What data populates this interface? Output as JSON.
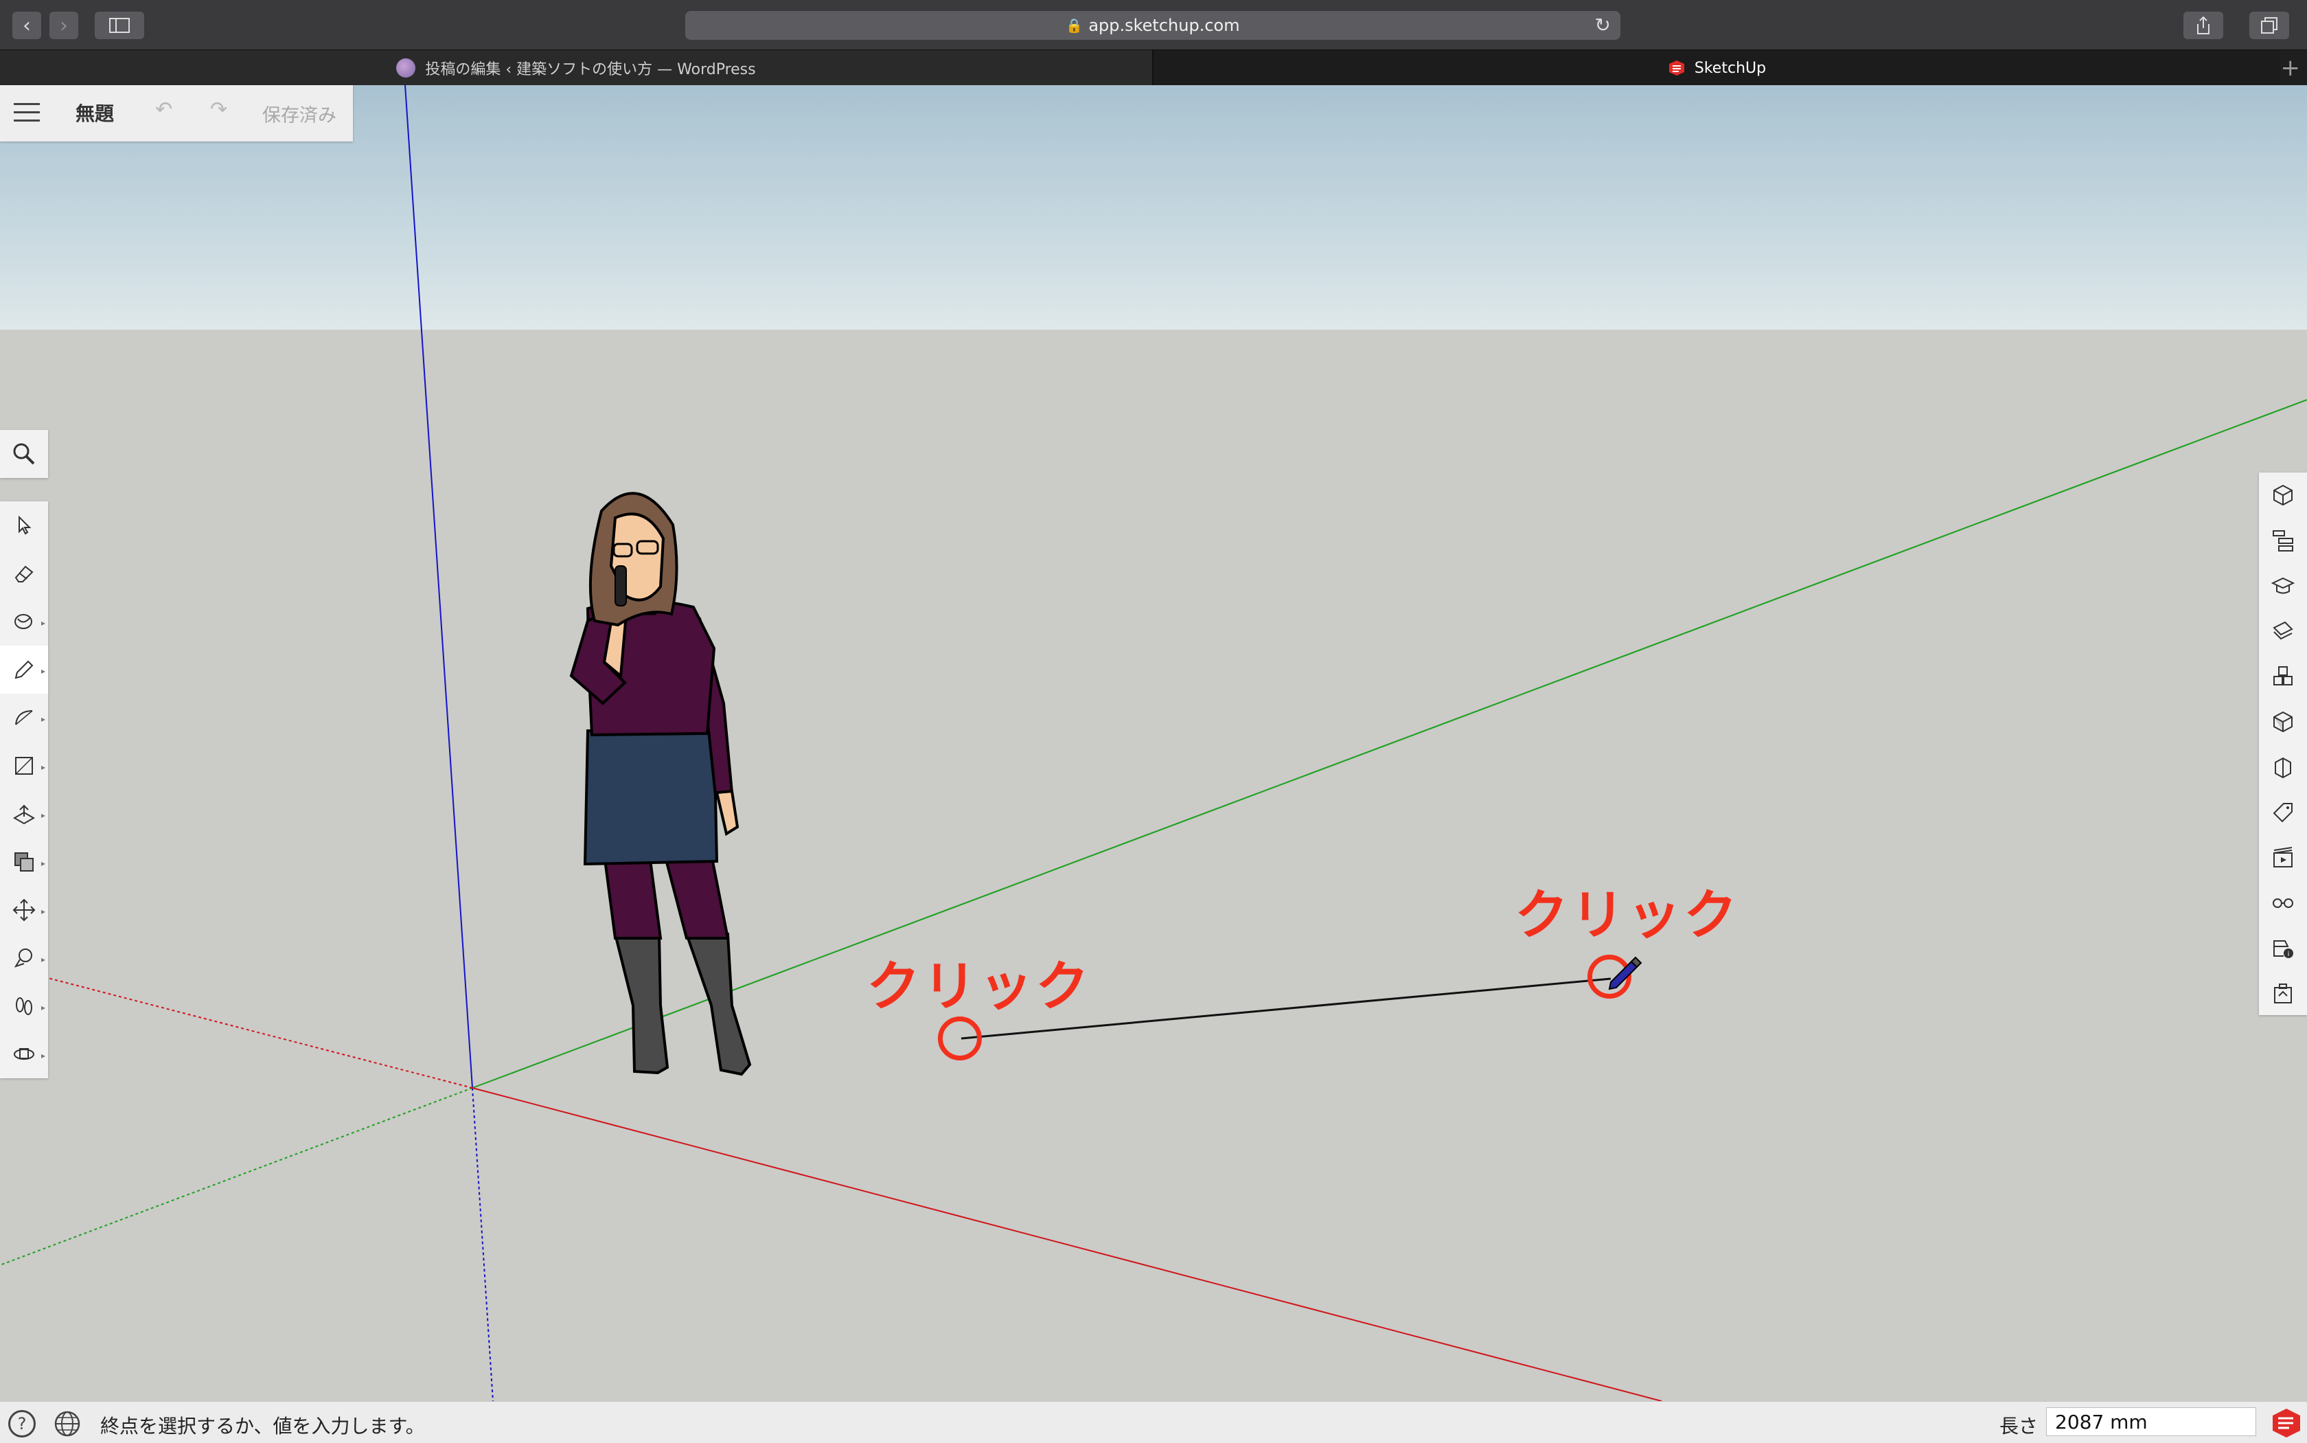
{
  "browser": {
    "url": "app.sketchup.com",
    "tabs": [
      {
        "label": "投稿の編集 ‹ 建築ソフトの使い方 — WordPress"
      },
      {
        "label": "SketchUp"
      }
    ]
  },
  "app": {
    "title": "無題",
    "save_status": "保存済み"
  },
  "annotations": {
    "click_start": "クリック",
    "click_end": "クリック"
  },
  "status_bar": {
    "hint": "終点を選択するか、値を入力します。",
    "length_label": "長さ",
    "length_value": "2087 mm"
  },
  "colors": {
    "axis_red": "#d0151a",
    "axis_green": "#1fa01f",
    "axis_blue": "#1414c8",
    "annotation_red": "#f2311c",
    "sketchup_brand": "#e22b27"
  },
  "left_tools": [
    "search-icon",
    "select-icon",
    "eraser-icon",
    "paint-bucket-icon",
    "pencil-icon",
    "arc-icon",
    "rectangle-icon",
    "push-pull-icon",
    "offset-icon",
    "move-icon",
    "tape-measure-icon",
    "walk-icon",
    "orbit-icon"
  ],
  "right_panels": [
    "entity-info-icon",
    "outliner-icon",
    "instructor-icon",
    "materials-icon",
    "components-icon",
    "solid-tools-icon",
    "styles-icon",
    "tags-icon",
    "scenes-icon",
    "display-icon",
    "model-info-icon",
    "extension-icon"
  ]
}
